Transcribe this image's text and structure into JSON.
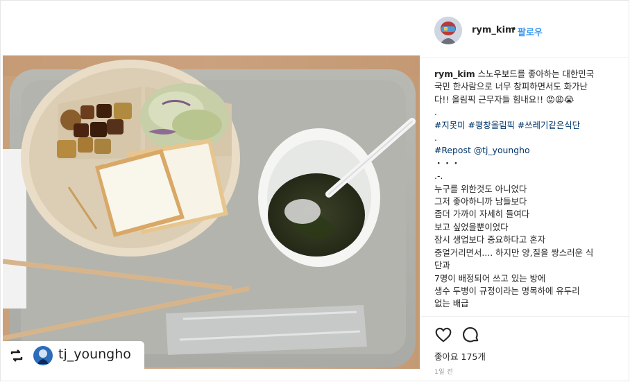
{
  "post": {
    "author": "rym_kim",
    "follow_sep": "•",
    "follow_label": "팔로우",
    "caption_lines": [
      {
        "user": "rym_kim",
        "text": " 스노우보드를 좋아하는 대한민국"
      },
      {
        "text": "국민 한사람으로 너무 창피하면서도 화가난"
      },
      {
        "text": "다!! 올림픽 근무자들 힘내요!! 😡😩😭"
      },
      {
        "text": "."
      },
      {
        "text": "#지못미 #평창올림픽 #쓰레기같은식단",
        "tag": true
      },
      {
        "text": "."
      },
      {
        "text": "#Repost @tj_youngho",
        "tag": true
      },
      {
        "text": "・・・"
      },
      {
        "text": ".-."
      },
      {
        "text": "누구를 위한것도 아니었다"
      },
      {
        "text": "그저 좋아하니까 남들보다"
      },
      {
        "text": "좀더 가까이 자세히 들여다"
      },
      {
        "text": "보고 싶었을뿐이었다"
      },
      {
        "text": "잠시 생업보다 중요하다고 혼자"
      },
      {
        "text": "중얼거리면서.... 하지만 양,질을 쌍스러운 식"
      },
      {
        "text": "단과"
      },
      {
        "text": "7명이 배정되어 쓰고 있는 방에"
      },
      {
        "text": "생수 두병이 규정이라는 명목하에 유두리"
      },
      {
        "text": "없는 배급"
      }
    ],
    "likes_label": "좋아요",
    "likes_count": "175개",
    "time": "1일 전"
  },
  "photo": {
    "repost_user": "tj_youngho"
  },
  "icons": {
    "heart": "heart-icon",
    "comment": "comment-icon",
    "repost": "repost-icon"
  },
  "colors": {
    "link": "#3897f0",
    "hashtag": "#003569",
    "text": "#262626",
    "muted": "#999999"
  }
}
